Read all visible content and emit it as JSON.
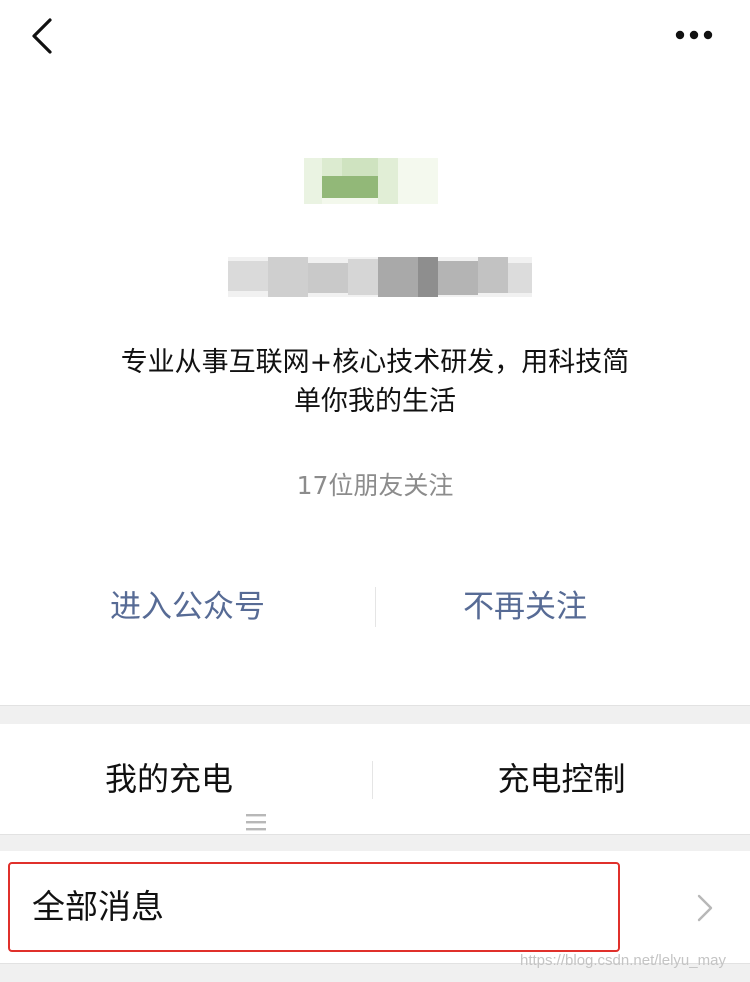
{
  "header": {
    "back_icon": "chevron-left-icon",
    "more_icon": "more-horizontal-icon"
  },
  "profile": {
    "intro_line1": "专业从事互联网+核心技术研发，用科技简",
    "intro_line2": "单你我的生活",
    "followers_text": "17位朋友关注"
  },
  "actions": {
    "enter_label": "进入公众号",
    "unfollow_label": "不再关注",
    "link_color": "#576b95"
  },
  "menu": {
    "items": [
      {
        "label": "我的充电",
        "icon": "submenu-list-icon"
      },
      {
        "label": "充电控制"
      }
    ]
  },
  "messages": {
    "all_label": "全部消息",
    "highlight_color": "#e0302b"
  },
  "watermark": "https://blog.csdn.net/lelyu_may"
}
